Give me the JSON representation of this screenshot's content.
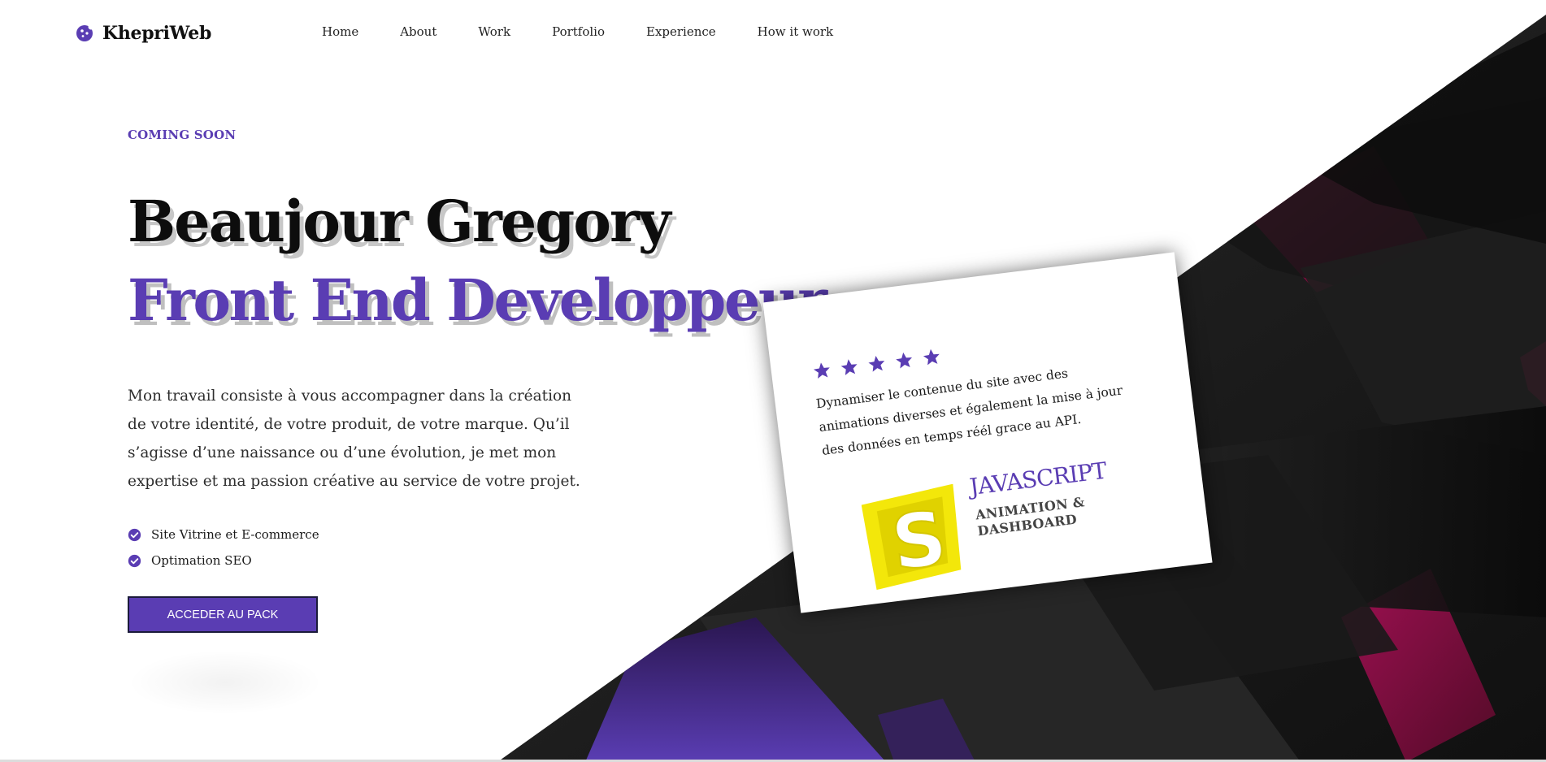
{
  "colors": {
    "accent": "#5a3db3",
    "dark": "#1c1c1c",
    "magenta": "#8a0f3d",
    "star": "#5a3db3",
    "js_yellow": "#f3e70a"
  },
  "brand": {
    "name": "KhepriWeb",
    "icon": "cookie-icon"
  },
  "nav": {
    "items": [
      {
        "label": "Home"
      },
      {
        "label": "About"
      },
      {
        "label": "Work"
      },
      {
        "label": "Portfolio"
      },
      {
        "label": "Experience"
      },
      {
        "label": "How it work"
      }
    ]
  },
  "hero": {
    "eyebrow": "COMING SOON",
    "title": "Beaujour Gregory",
    "subtitle": "Front End Developpeur",
    "description": "Mon travail consiste à vous accompagner dans la création de votre identité, de votre produit, de votre marque. Qu’il s’agisse d’une naissance ou d’une évolution, je met mon expertise et ma passion créative au service de votre projet.",
    "features": [
      {
        "label": "Site Vitrine et E-commerce",
        "icon": "check-circle-icon"
      },
      {
        "label": "Optimation SEO",
        "icon": "check-circle-icon"
      }
    ],
    "cta_label": "ACCEDER AU PACK"
  },
  "card": {
    "rating": 5,
    "star_icon": "star-icon",
    "text": "Dynamiser le contenue du site avec des animations diverses et également la mise à jour des données en temps réél grace au API.",
    "logo_icon": "js-shield-icon",
    "logo_glyph": "S",
    "title": "JAVASCRIPT",
    "sub_line1": "ANIMATION &",
    "sub_line2": "DASHBOARD"
  }
}
